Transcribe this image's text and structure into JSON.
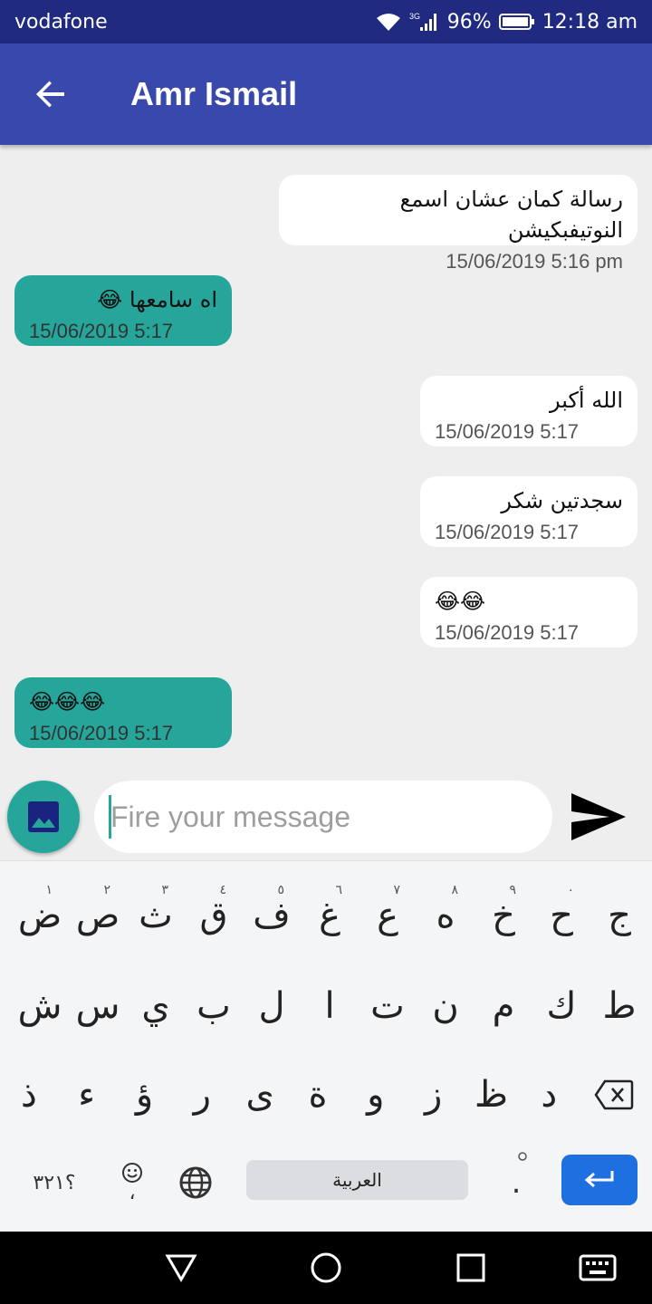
{
  "status_bar": {
    "carrier": "vodafone",
    "network": "3G",
    "battery": "96%",
    "time": "12:18 am"
  },
  "app_bar": {
    "title": "Amr Ismail"
  },
  "messages": [
    {
      "direction": "outgoing",
      "text": "رسالة كمان عشان اسمع النوتيفبكيشن",
      "time": "15/06/2019 5:16 pm"
    },
    {
      "direction": "incoming",
      "text": "اه سامعها 😂",
      "time": "15/06/2019 5:17"
    },
    {
      "direction": "outgoing",
      "text": "الله أكبر",
      "time": "15/06/2019 5:17"
    },
    {
      "direction": "outgoing",
      "text": "سجدتين شكر",
      "time": "15/06/2019 5:17"
    },
    {
      "direction": "outgoing",
      "text": "😂😂",
      "time": "15/06/2019 5:17"
    },
    {
      "direction": "incoming",
      "text": "😂😂😂",
      "time": "15/06/2019 5:17"
    }
  ],
  "composer": {
    "placeholder": "Fire your message",
    "value": ""
  },
  "keyboard": {
    "row1": [
      {
        "char": "ض",
        "hint": "١"
      },
      {
        "char": "ص",
        "hint": "٢"
      },
      {
        "char": "ث",
        "hint": "٣"
      },
      {
        "char": "ق",
        "hint": "٤"
      },
      {
        "char": "ف",
        "hint": "٥"
      },
      {
        "char": "غ",
        "hint": "٦"
      },
      {
        "char": "ع",
        "hint": "٧"
      },
      {
        "char": "ه",
        "hint": "٨"
      },
      {
        "char": "خ",
        "hint": "٩"
      },
      {
        "char": "ح",
        "hint": "٠"
      },
      {
        "char": "ج",
        "hint": ""
      }
    ],
    "row2": [
      "ش",
      "س",
      "ي",
      "ب",
      "ل",
      "ا",
      "ت",
      "ن",
      "م",
      "ك",
      "ط"
    ],
    "row3": [
      "ذ",
      "ء",
      "ؤ",
      "ر",
      "ى",
      "ة",
      "و",
      "ز",
      "ظ",
      "د"
    ],
    "symbols_key": "؟٣٢١",
    "comma_key": "،",
    "space_label": "العربية",
    "period_key": "."
  },
  "colors": {
    "status_bar": "#1f2a80",
    "app_bar": "#3949ab",
    "incoming_bubble": "#26a69a",
    "outgoing_bubble": "#ffffff",
    "enter_key": "#1e6fe0"
  }
}
